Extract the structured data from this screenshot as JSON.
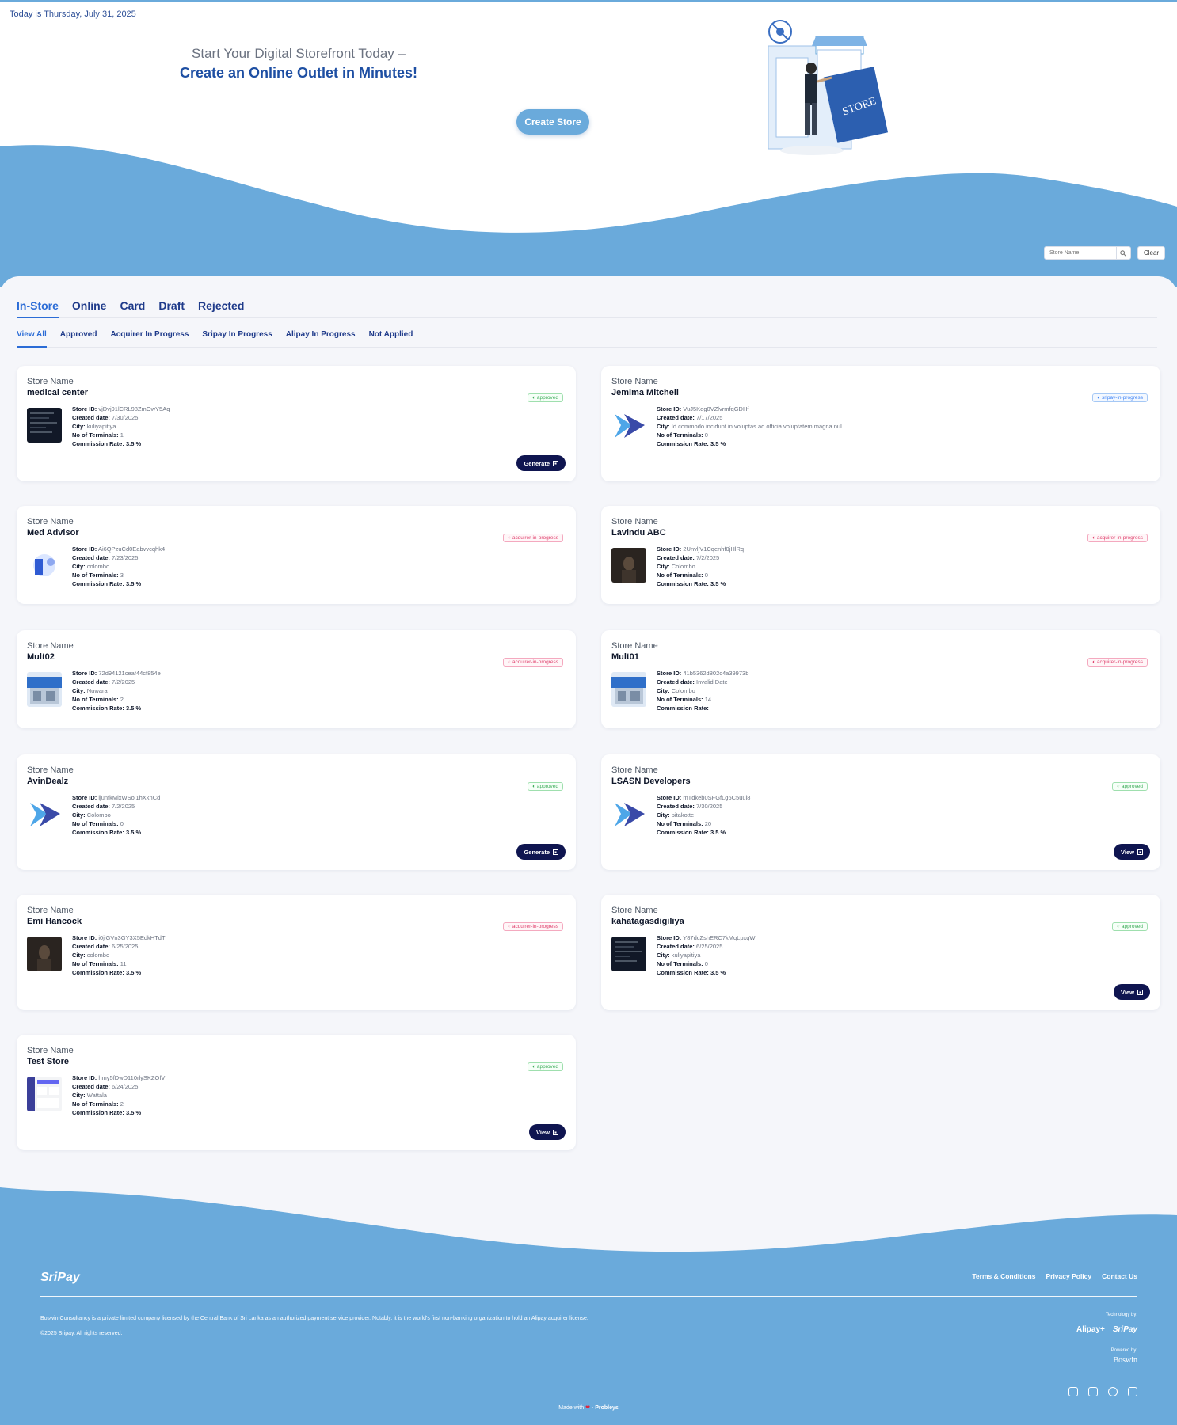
{
  "header": {
    "date_text": "Today is Thursday, July 31, 2025",
    "headline_line1": "Start Your Digital Storefront Today –",
    "headline_line2": "Create an Online Outlet in Minutes!",
    "create_store_label": "Create Store",
    "illustration_sign": "STORE"
  },
  "search": {
    "placeholder": "Store Name",
    "clear_label": "Clear"
  },
  "tabs": [
    "In-Store",
    "Online",
    "Card",
    "Draft",
    "Rejected"
  ],
  "active_tab": "In-Store",
  "subtabs": [
    "View All",
    "Approved",
    "Acquirer In Progress",
    "Sripay In Progress",
    "Alipay In Progress",
    "Not Applied"
  ],
  "active_subtab": "View All",
  "field_labels": {
    "store_name": "Store Name",
    "store_id": "Store ID:",
    "created_date": "Created date:",
    "city": "City:",
    "terminals": "No of Terminals:",
    "commission": "Commission Rate:"
  },
  "stores": [
    {
      "name": "medical center",
      "store_id": "vjDvj91lCRL98ZmOwY5Aq",
      "created": "7/30/2025",
      "city": "kuliyapitiya",
      "terminals": "1",
      "commission": "3.5 %",
      "status": "approved",
      "action": "Generate",
      "thumb": "dark-screen"
    },
    {
      "name": "Jemima Mitchell",
      "store_id": "VuJ5Keg0VZlvrmfqGDHf",
      "created": "7/17/2025",
      "city": "Id commodo incidunt in voluptas ad officia voluptatem magna nul",
      "terminals": "0",
      "commission": "3.5 %",
      "status": "sripay-in-progress",
      "action": "",
      "thumb": "play-logo"
    },
    {
      "name": "Med Advisor",
      "store_id": "Ai6QPzuCd0Eabvvcqhk4",
      "created": "7/23/2025",
      "city": "colombo",
      "terminals": "3",
      "commission": "3.5 %",
      "status": "acquirer-in-progress",
      "action": "",
      "thumb": "illustration"
    },
    {
      "name": "Lavindu ABC",
      "store_id": "2UnvljV1Cqenhf0jHlRq",
      "created": "7/2/2025",
      "city": "Colombo",
      "terminals": "0",
      "commission": "3.5 %",
      "status": "acquirer-in-progress",
      "action": "",
      "thumb": "dark-photo"
    },
    {
      "name": "Mult02",
      "store_id": "72d94121ceaf44cf854e",
      "created": "7/2/2025",
      "city": "Nuwara",
      "terminals": "2",
      "commission": "3.5 %",
      "status": "acquirer-in-progress",
      "action": "",
      "thumb": "storefront"
    },
    {
      "name": "Mult01",
      "store_id": "41b5362d802c4a39973b",
      "created": "Invalid Date",
      "city": "Colombo",
      "terminals": "14",
      "commission": "",
      "status": "acquirer-in-progress",
      "action": "",
      "thumb": "storefront"
    },
    {
      "name": "AvinDealz",
      "store_id": "ijunfkMlxWSoi1hXknCd",
      "created": "7/2/2025",
      "city": "Colombo",
      "terminals": "0",
      "commission": "3.5 %",
      "status": "approved",
      "action": "Generate",
      "thumb": "play-logo"
    },
    {
      "name": "LSASN Developers",
      "store_id": "mTdkeb0SFGfLg6C5uui8",
      "created": "7/30/2025",
      "city": "pitakotte",
      "terminals": "20",
      "commission": "3.5 %",
      "status": "approved",
      "action": "View",
      "thumb": "play-logo"
    },
    {
      "name": "Emi Hancock",
      "store_id": "i0jlGVn3GY3X5EdkHTdT",
      "created": "6/25/2025",
      "city": "colombo",
      "terminals": "11",
      "commission": "3.5 %",
      "status": "acquirer-in-progress",
      "action": "",
      "thumb": "dark-photo"
    },
    {
      "name": "kahatagasdigiliya",
      "store_id": "Y87dcZshERC7kMqLpxqW",
      "created": "6/25/2025",
      "city": "kuliyapitiya",
      "terminals": "0",
      "commission": "3.5 %",
      "status": "approved",
      "action": "View",
      "thumb": "dark-screen"
    },
    {
      "name": "Test Store",
      "store_id": "hmy5fDwD110rlySKZOfV",
      "created": "6/24/2025",
      "city": "Wattala",
      "terminals": "2",
      "commission": "3.5 %",
      "status": "approved",
      "action": "View",
      "thumb": "dashboard"
    }
  ],
  "footer": {
    "logo": "SriPay",
    "links": [
      "Terms & Conditions",
      "Privacy Policy",
      "Contact Us"
    ],
    "description": "Boswin Consultancy is a private limited company licensed by the Central Bank of Sri Lanka as an authorized payment service provider. Notably, it is the world's first non-banking organization to hold an Alipay acquirer license.",
    "copyright": "©2025 Sripay. All rights reserved.",
    "technology_by": "Technology by:",
    "brand1": "Alipay+",
    "brand2": "SriPay",
    "powered_by": "Powered by:",
    "powered_brand": "Boswin",
    "made_with": "Made with",
    "by": "-",
    "maker": "Probleys"
  },
  "colors": {
    "accent": "#6aaadb",
    "primary_text": "#1e4fa3",
    "button_dark": "#0f1550",
    "approved": "#3fae5b",
    "sripay": "#3b82f6",
    "acquirer": "#e0436f"
  }
}
